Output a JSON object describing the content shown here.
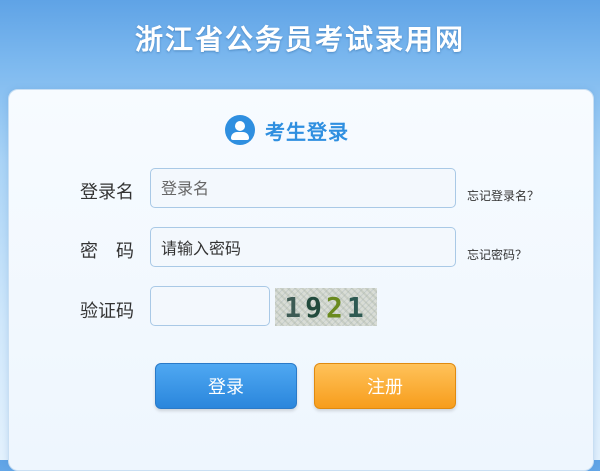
{
  "site": {
    "title": "浙江省公务员考试录用网"
  },
  "panel": {
    "title": "考生登录"
  },
  "form": {
    "username_label": "登录名",
    "username_placeholder": "登录名",
    "username_value": "",
    "forgot_username": "忘记登录名？",
    "password_label": "密　码",
    "password_placeholder": "请输入密码",
    "password_value": "请输入密码",
    "forgot_password": "忘记密码？",
    "captcha_label": "验证码",
    "captcha_value": "",
    "captcha_digits": [
      "1",
      "9",
      "2",
      "1"
    ]
  },
  "buttons": {
    "login": "登录",
    "register": "注册"
  },
  "colors": {
    "accent_blue": "#2f8fe0",
    "register_orange": "#f79d1c",
    "background_top": "#5fa3e6"
  }
}
